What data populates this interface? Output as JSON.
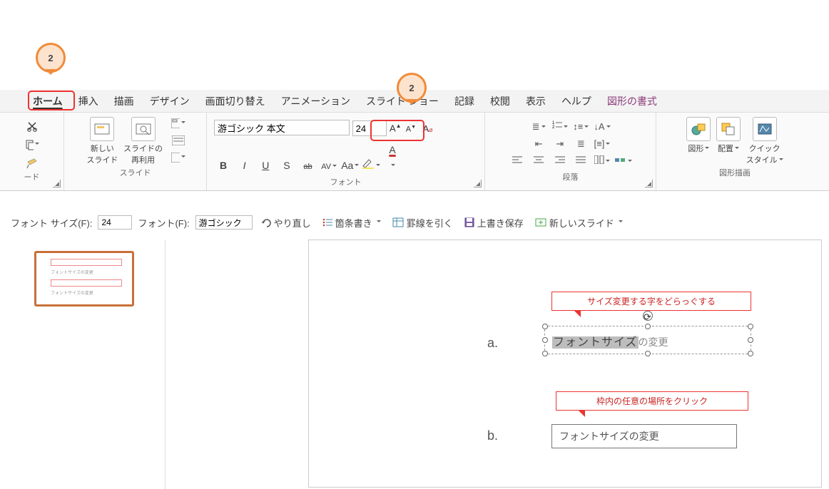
{
  "callouts": {
    "c1": "2",
    "c2": "2"
  },
  "tabs": [
    "ホーム",
    "挿入",
    "描画",
    "デザイン",
    "画面切り替え",
    "アニメーション",
    "スライド ショー",
    "記録",
    "校閲",
    "表示",
    "ヘルプ"
  ],
  "contextual_tab": "図形の書式",
  "ribbon": {
    "clipboard": {
      "group": "ード",
      "cut": "切り取り",
      "copy": "コピー",
      "paint": "書式のコピー"
    },
    "slides": {
      "group": "スライド",
      "new_slide": "新しい\nスライド",
      "reuse": "スライドの\n再利用"
    },
    "font": {
      "group": "フォント",
      "name_value": "游ゴシック 本文",
      "size_value": "24",
      "bold": "B",
      "italic": "I",
      "underline": "U",
      "strike": "S",
      "strike2": "ab",
      "spacing": "AV",
      "case": "Aa",
      "grow": "A",
      "shrink": "A",
      "clear": "A"
    },
    "paragraph": {
      "group": "段落"
    },
    "drawing": {
      "group": "図形描画",
      "shapes": "図形",
      "arrange": "配置",
      "qstyle": "クイック\nスタイル"
    }
  },
  "qat": {
    "fontsize_label": "フォント サイズ(F):",
    "fontsize_value": "24",
    "font_label": "フォント(F):",
    "font_value": "游ゴシック",
    "redo": "やり直し",
    "bullets": "箇条書き",
    "ruler": "罫線を引く",
    "save": "上書き保存",
    "new_slide": "新しいスライド"
  },
  "slide": {
    "bullet_a": "a.",
    "bullet_b": "b.",
    "callout_a": "サイズ変更する字をどらっぐする",
    "sel_text": "フォントサイズ",
    "sel_tail": "の変更",
    "callout_b": "枠内の任意の場所をクリック",
    "box_b": "フォントサイズの変更"
  }
}
